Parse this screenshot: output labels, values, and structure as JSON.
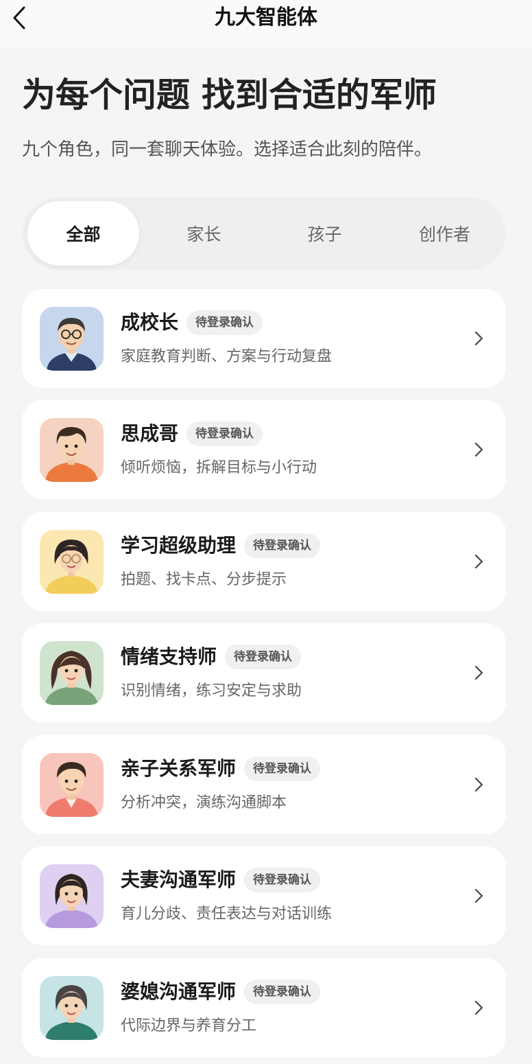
{
  "header": {
    "title": "九大智能体",
    "back_icon": "chevron-left-icon"
  },
  "hero": {
    "title": "为每个问题 找到合适的军师",
    "subtitle": "九个角色，同一套聊天体验。选择适合此刻的陪伴。"
  },
  "tabs": [
    {
      "label": "全部",
      "active": true
    },
    {
      "label": "家长",
      "active": false
    },
    {
      "label": "孩子",
      "active": false
    },
    {
      "label": "创作者",
      "active": false
    }
  ],
  "agents": [
    {
      "name": "成校长",
      "badge": "待登录确认",
      "desc": "家庭教育判断、方案与行动复盘",
      "avatar_bg": "#c6d6ec"
    },
    {
      "name": "思成哥",
      "badge": "待登录确认",
      "desc": "倾听烦恼，拆解目标与小行动",
      "avatar_bg": "#f6d3c1"
    },
    {
      "name": "学习超级助理",
      "badge": "待登录确认",
      "desc": "拍题、找卡点、分步提示",
      "avatar_bg": "#fbe7b2"
    },
    {
      "name": "情绪支持师",
      "badge": "待登录确认",
      "desc": "识别情绪，练习安定与求助",
      "avatar_bg": "#cfe3cf"
    },
    {
      "name": "亲子关系军师",
      "badge": "待登录确认",
      "desc": "分析冲突，演练沟通脚本",
      "avatar_bg": "#f8c5bc"
    },
    {
      "name": "夫妻沟通军师",
      "badge": "待登录确认",
      "desc": "育儿分歧、责任表达与对话训练",
      "avatar_bg": "#ddd0f0"
    },
    {
      "name": "婆媳沟通军师",
      "badge": "待登录确认",
      "desc": "代际边界与养育分工",
      "avatar_bg": "#c6e4e6"
    }
  ],
  "colors": {
    "page_bg": "#f5f5f5",
    "card_bg": "#ffffff",
    "tab_track": "#eeeff1",
    "badge_bg": "#f0f0f2"
  }
}
